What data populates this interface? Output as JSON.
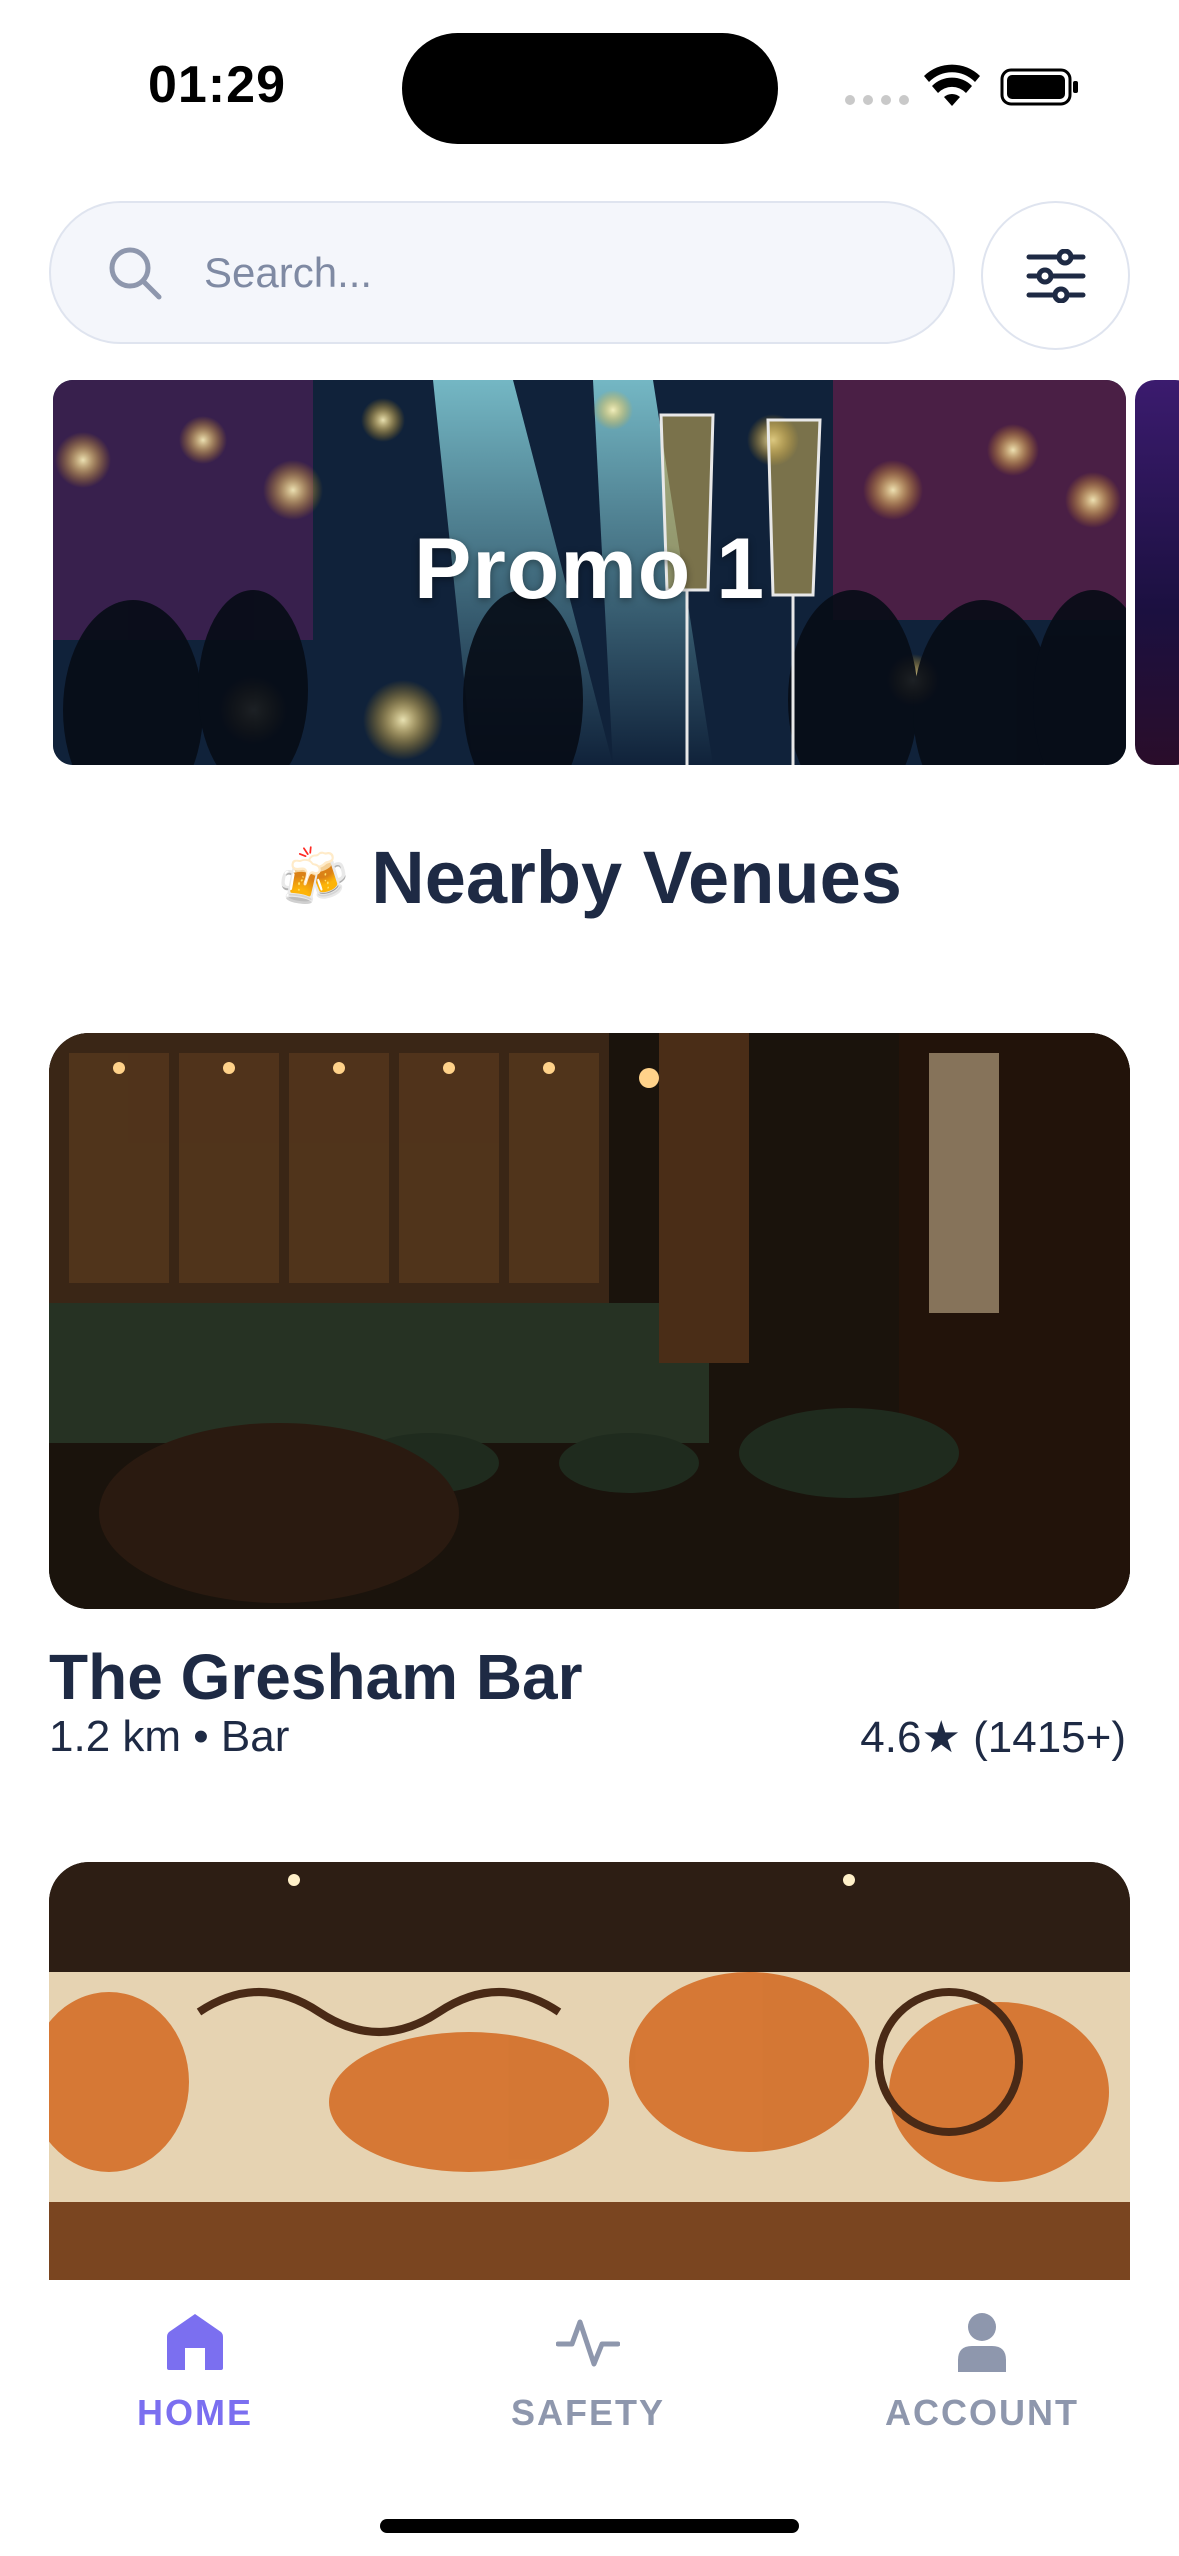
{
  "status_bar": {
    "time": "01:29"
  },
  "search": {
    "placeholder": "Search..."
  },
  "promo": {
    "title": "Promo 1"
  },
  "section": {
    "emoji": "🍻",
    "title": "Nearby Venues"
  },
  "venues": [
    {
      "name": "The Gresham Bar",
      "meta": "1.2 km • Bar",
      "rating": "4.6★ (1415+)"
    }
  ],
  "tabs": [
    {
      "label": "HOME",
      "icon": "home-icon",
      "active": true
    },
    {
      "label": "SAFETY",
      "icon": "pulse-icon",
      "active": false
    },
    {
      "label": "ACCOUNT",
      "icon": "user-icon",
      "active": false
    }
  ],
  "colors": {
    "accent": "#7b6ff0",
    "text": "#1e2a44",
    "muted": "#8e97ad",
    "search_bg": "#f4f6fb"
  }
}
